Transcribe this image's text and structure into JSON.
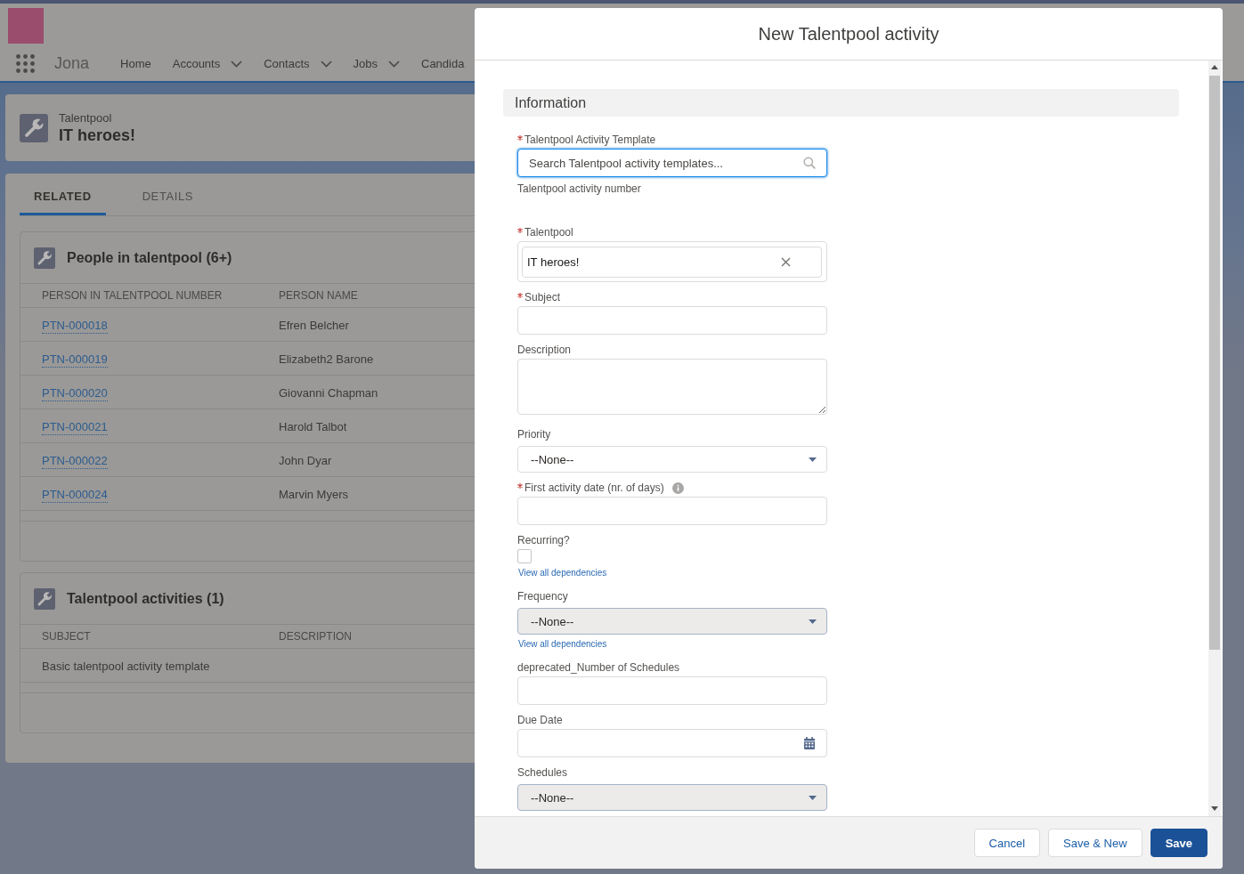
{
  "header": {
    "app_name": "Jona",
    "nav": [
      {
        "label": "Home",
        "has_menu": false
      },
      {
        "label": "Accounts",
        "has_menu": true
      },
      {
        "label": "Contacts",
        "has_menu": true
      },
      {
        "label": "Jobs",
        "has_menu": true
      },
      {
        "label": "Candida",
        "has_menu": false
      }
    ]
  },
  "record": {
    "type": "Talentpool",
    "name": "IT heroes!"
  },
  "tabs": [
    {
      "label": "RELATED",
      "selected": true
    },
    {
      "label": "DETAILS",
      "selected": false
    }
  ],
  "related_lists": [
    {
      "title": "People in talentpool (6+)",
      "columns": [
        {
          "label": "PERSON IN TALENTPOOL NUMBER",
          "kind": "link"
        },
        {
          "label": "PERSON NAME",
          "kind": "text"
        }
      ],
      "rows": [
        [
          "PTN-000018",
          "Efren Belcher"
        ],
        [
          "PTN-000019",
          "Elizabeth2 Barone"
        ],
        [
          "PTN-000020",
          "Giovanni Chapman"
        ],
        [
          "PTN-000021",
          "Harold Talbot"
        ],
        [
          "PTN-000022",
          "John Dyar"
        ],
        [
          "PTN-000024",
          "Marvin Myers"
        ]
      ]
    },
    {
      "title": "Talentpool activities (1)",
      "columns": [
        {
          "label": "SUBJECT",
          "kind": "text"
        },
        {
          "label": "DESCRIPTION",
          "kind": "text"
        }
      ],
      "rows": [
        [
          "Basic talentpool activity template"
        ]
      ]
    }
  ],
  "modal": {
    "title": "New Talentpool activity",
    "section": "Information",
    "fields": [
      {
        "kind": "lookup",
        "label": "Talentpool Activity Template",
        "required": true,
        "help": false,
        "placeholder": "Search Talentpool activity templates...",
        "disabled": false,
        "focused": true
      },
      {
        "kind": "output",
        "label": "Talentpool activity number",
        "required": false,
        "help": false
      },
      {
        "kind": "pill_lookup",
        "label": "Talentpool",
        "required": true,
        "help": false,
        "value": "IT heroes!",
        "disabled": false,
        "focused": false
      },
      {
        "kind": "text",
        "label": "Subject",
        "required": true,
        "help": false,
        "disabled": false,
        "focused": false
      },
      {
        "kind": "textarea",
        "label": "Description",
        "required": false,
        "help": false,
        "disabled": false,
        "focused": false
      },
      {
        "kind": "select",
        "label": "Priority",
        "required": false,
        "help": false,
        "value": "--None--",
        "disabled": false,
        "focused": false
      },
      {
        "kind": "text",
        "label": "First activity date (nr. of days)",
        "required": true,
        "help": true,
        "disabled": false,
        "focused": false
      },
      {
        "kind": "checkbox",
        "label": "Recurring?",
        "required": false,
        "help": false,
        "checked": false,
        "disabled": false,
        "focused": false,
        "link": "View all dependencies"
      },
      {
        "kind": "select",
        "label": "Frequency",
        "required": false,
        "help": false,
        "value": "--None--",
        "disabled": true,
        "focused": false,
        "link": "View all dependencies"
      },
      {
        "kind": "text",
        "label": "deprecated_Number of Schedules",
        "required": false,
        "help": false,
        "disabled": false,
        "focused": false
      },
      {
        "kind": "date",
        "label": "Due Date",
        "required": false,
        "help": false,
        "disabled": false,
        "focused": false
      },
      {
        "kind": "select",
        "label": "Schedules",
        "required": false,
        "help": false,
        "value": "--None--",
        "disabled": true,
        "focused": false
      }
    ],
    "buttons": [
      {
        "label": "Cancel",
        "kind": "neutral"
      },
      {
        "label": "Save & New",
        "kind": "neutral"
      },
      {
        "label": "Save",
        "kind": "brand"
      }
    ]
  }
}
